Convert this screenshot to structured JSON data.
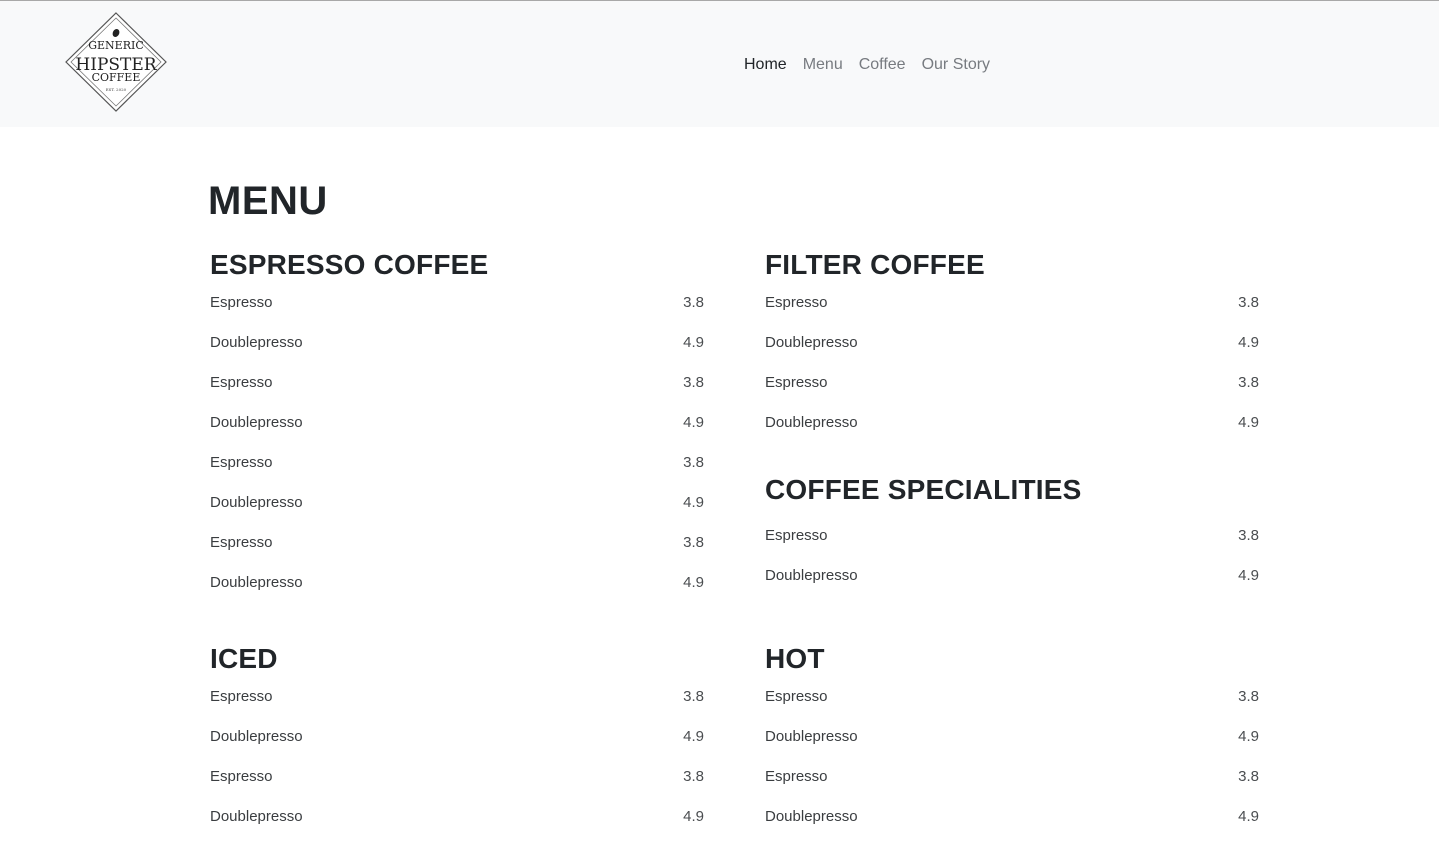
{
  "brand": {
    "logo_lines": [
      "GENERIC",
      "HIPSTER",
      "COFFEE",
      "EST. 2020"
    ]
  },
  "nav": {
    "items": [
      {
        "label": "Home",
        "active": true
      },
      {
        "label": "Menu",
        "active": false
      },
      {
        "label": "Coffee",
        "active": false
      },
      {
        "label": "Our Story",
        "active": false
      }
    ]
  },
  "page": {
    "title": "MENU"
  },
  "sections": {
    "espresso": {
      "title": "ESPRESSO COFFEE",
      "items": [
        {
          "name": "Espresso",
          "price": "3.8"
        },
        {
          "name": "Doublepresso",
          "price": "4.9"
        },
        {
          "name": "Espresso",
          "price": "3.8"
        },
        {
          "name": "Doublepresso",
          "price": "4.9"
        },
        {
          "name": "Espresso",
          "price": "3.8"
        },
        {
          "name": "Doublepresso",
          "price": "4.9"
        },
        {
          "name": "Espresso",
          "price": "3.8"
        },
        {
          "name": "Doublepresso",
          "price": "4.9"
        }
      ]
    },
    "filter": {
      "title": "FILTER COFFEE",
      "items": [
        {
          "name": "Espresso",
          "price": "3.8"
        },
        {
          "name": "Doublepresso",
          "price": "4.9"
        },
        {
          "name": "Espresso",
          "price": "3.8"
        },
        {
          "name": "Doublepresso",
          "price": "4.9"
        }
      ]
    },
    "specialities": {
      "title": "COFFEE SPECIALITIES",
      "items": [
        {
          "name": "Espresso",
          "price": "3.8"
        },
        {
          "name": "Doublepresso",
          "price": "4.9"
        }
      ]
    },
    "iced": {
      "title": "ICED",
      "items": [
        {
          "name": "Espresso",
          "price": "3.8"
        },
        {
          "name": "Doublepresso",
          "price": "4.9"
        },
        {
          "name": "Espresso",
          "price": "3.8"
        },
        {
          "name": "Doublepresso",
          "price": "4.9"
        }
      ]
    },
    "hot": {
      "title": "HOT",
      "items": [
        {
          "name": "Espresso",
          "price": "3.8"
        },
        {
          "name": "Doublepresso",
          "price": "4.9"
        },
        {
          "name": "Espresso",
          "price": "3.8"
        },
        {
          "name": "Doublepresso",
          "price": "4.9"
        }
      ]
    }
  }
}
